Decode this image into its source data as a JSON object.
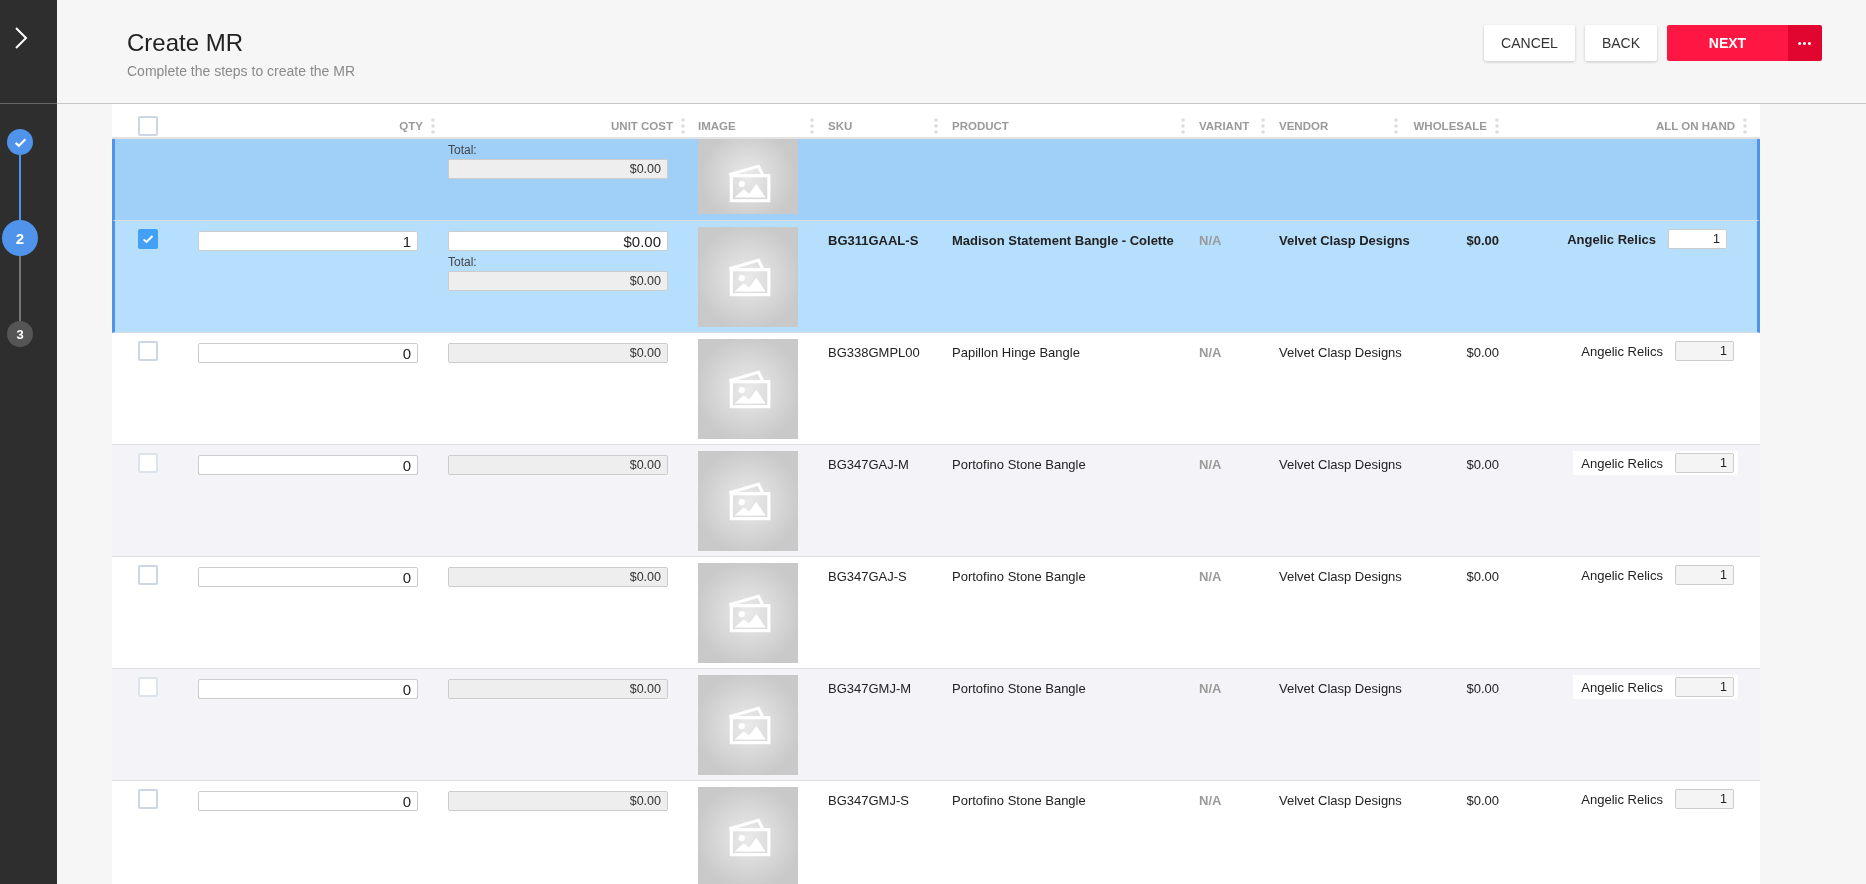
{
  "header": {
    "title": "Create MR",
    "subtitle": "Complete the steps to create the MR",
    "buttons": [
      {
        "label": "CANCEL",
        "kind": "plain"
      },
      {
        "label": "BACK",
        "kind": "plain"
      },
      {
        "label": "NEXT",
        "kind": "primary"
      }
    ],
    "more_label": "•••"
  },
  "steps": [
    {
      "done": true,
      "current": false
    },
    {
      "label": "2",
      "done": false,
      "current": true
    },
    {
      "label": "3",
      "done": false,
      "current": false
    }
  ],
  "table": {
    "select_all": {
      "checked": false
    },
    "columns": [
      "QTY",
      "UNIT COST",
      "IMAGE",
      "SKU",
      "PRODUCT",
      "VARIANT",
      "VENDOR",
      "WHOLESALE",
      "ALL ON HAND"
    ],
    "rows": [
      {
        "kind": "partial",
        "selected": true,
        "total_label": "Total:",
        "total": "$0.00"
      },
      {
        "kind": "item",
        "selected": true,
        "qty": "1",
        "unit_cost": "$0.00",
        "total_label": "Total:",
        "total": "$0.00",
        "sku": "BG311GAAL-S",
        "product": "Madison Statement Bangle - Colette",
        "variant": "N/A",
        "vendor": "Velvet Clasp Designs",
        "wholesale": "$0.00",
        "location": "Angelic Relics",
        "on_hand": "1"
      },
      {
        "kind": "item",
        "selected": false,
        "qty": "0",
        "unit_cost": "$0.00",
        "sku": "BG338GMPL00",
        "product": "Papillon Hinge Bangle",
        "variant": "N/A",
        "vendor": "Velvet Clasp Designs",
        "wholesale": "$0.00",
        "location": "Angelic Relics",
        "on_hand": "1"
      },
      {
        "kind": "item",
        "selected": false,
        "qty": "0",
        "unit_cost": "$0.00",
        "sku": "BG347GAJ-M",
        "product": "Portofino Stone Bangle",
        "variant": "N/A",
        "vendor": "Velvet Clasp Designs",
        "wholesale": "$0.00",
        "location": "Angelic Relics",
        "on_hand": "1"
      },
      {
        "kind": "item",
        "selected": false,
        "qty": "0",
        "unit_cost": "$0.00",
        "sku": "BG347GAJ-S",
        "product": "Portofino Stone Bangle",
        "variant": "N/A",
        "vendor": "Velvet Clasp Designs",
        "wholesale": "$0.00",
        "location": "Angelic Relics",
        "on_hand": "1"
      },
      {
        "kind": "item",
        "selected": false,
        "qty": "0",
        "unit_cost": "$0.00",
        "sku": "BG347GMJ-M",
        "product": "Portofino Stone Bangle",
        "variant": "N/A",
        "vendor": "Velvet Clasp Designs",
        "wholesale": "$0.00",
        "location": "Angelic Relics",
        "on_hand": "1"
      },
      {
        "kind": "item",
        "selected": false,
        "qty": "0",
        "unit_cost": "$0.00",
        "sku": "BG347GMJ-S",
        "product": "Portofino Stone Bangle",
        "variant": "N/A",
        "vendor": "Velvet Clasp Designs",
        "wholesale": "$0.00",
        "location": "Angelic Relics",
        "on_hand": "1"
      }
    ]
  }
}
